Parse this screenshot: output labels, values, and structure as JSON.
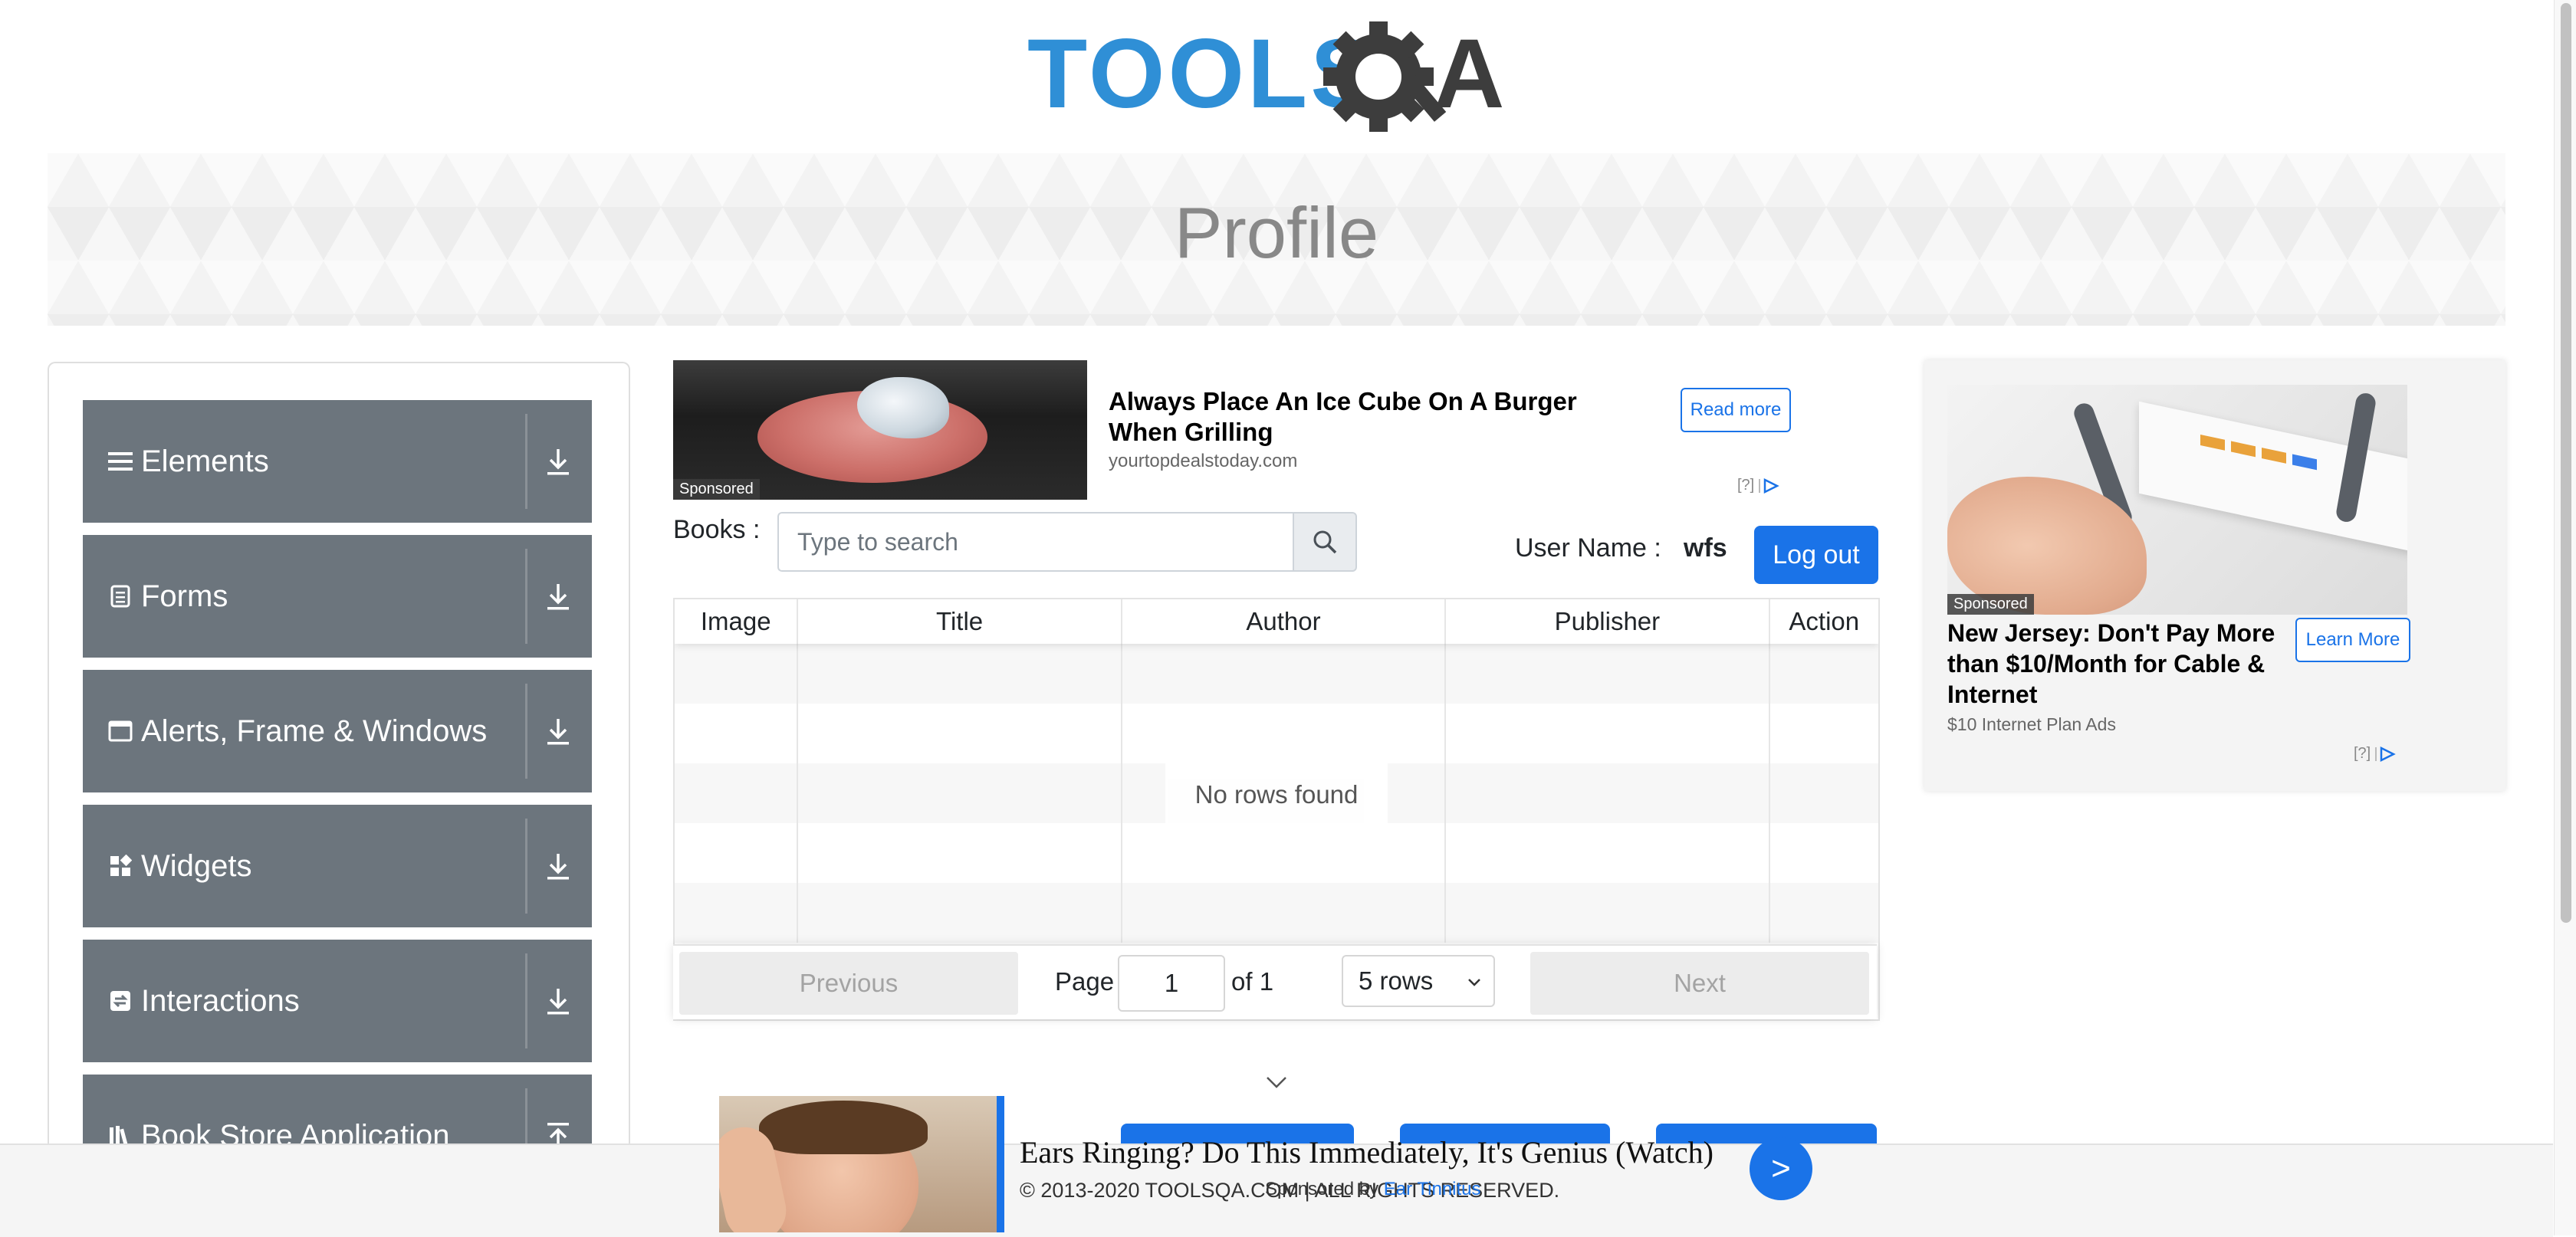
{
  "logo": {
    "text": "TOOLSQA"
  },
  "banner": {
    "title": "Profile"
  },
  "sidebar": {
    "groups": [
      {
        "label": "Elements",
        "icon": "hamburger-icon"
      },
      {
        "label": "Forms",
        "icon": "document-icon"
      },
      {
        "label": "Alerts, Frame & Windows",
        "icon": "window-icon"
      },
      {
        "label": "Widgets",
        "icon": "widgets-icon"
      },
      {
        "label": "Interactions",
        "icon": "interactions-icon"
      },
      {
        "label": "Book Store Application",
        "icon": "book-icon"
      }
    ]
  },
  "ad_top": {
    "badge": "Sponsored",
    "headline": "Always Place An Ice Cube On A Burger When Grilling",
    "source": "yourtopdealstoday.com",
    "cta": "Read more",
    "adchoices": "[?]"
  },
  "books": {
    "label": "Books :",
    "search_placeholder": "Type to search"
  },
  "user": {
    "label": "User Name :",
    "value": "wfs",
    "logout": "Log out"
  },
  "table": {
    "headers": [
      "Image",
      "Title",
      "Author",
      "Publisher",
      "Action"
    ],
    "empty_message": "No rows found"
  },
  "pagination": {
    "previous": "Previous",
    "page_label": "Page",
    "page_value": "1",
    "of_total": "of 1",
    "rows_option": "5 rows",
    "next": "Next"
  },
  "ad_right": {
    "badge": "Sponsored",
    "headline": "New Jersey: Don't Pay More than $10/Month for Cable & Internet",
    "source": "$10 Internet Plan Ads",
    "cta": "Learn More",
    "adchoices": "[?]"
  },
  "ad_bottom": {
    "headline": "Ears Ringing? Do This Immediately, It's Genius (Watch)",
    "go": ">"
  },
  "footer": {
    "copyright": "© 2013-2020 TOOLSQA.COM | ALL RIGHTS RESERVED.",
    "sponsored_by_prefix": "Sponsored by",
    "sponsored_by_name": "Ear Tinnitus"
  },
  "colors": {
    "accent": "#1a73e8",
    "sidebar_group": "#6c757d",
    "logo_blue": "#2f8fd6",
    "logo_dark": "#3d3d3d"
  }
}
